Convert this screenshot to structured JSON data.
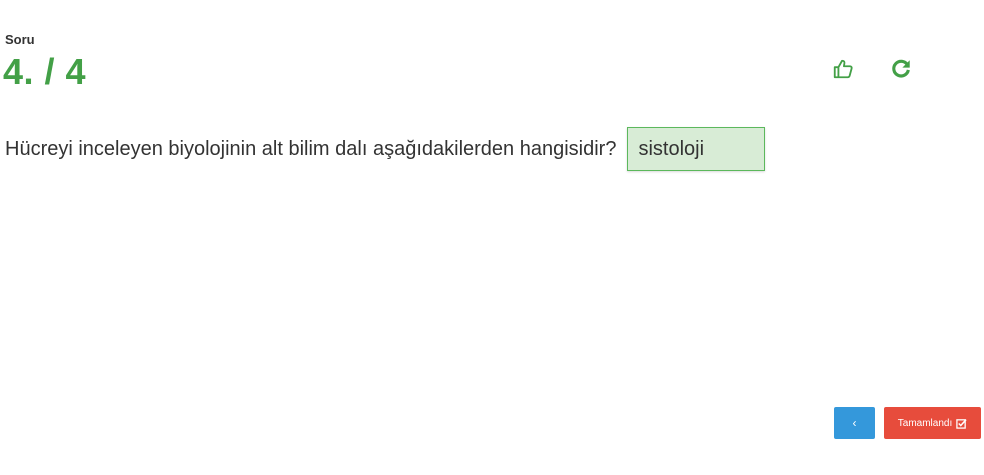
{
  "header": {
    "soru_label": "Soru",
    "counter": "4. / 4"
  },
  "actions": {
    "like_icon": "thumbs-up-icon",
    "redo_icon": "redo-icon"
  },
  "question": {
    "text": "Hücreyi inceleyen biyolojinin alt bilim dalı aşağıdakilerden hangisidir?",
    "answer_value": "sistoloji"
  },
  "footer": {
    "prev_label": "‹",
    "done_label": "Tamamlandı",
    "done_icon": "check-square-icon"
  },
  "colors": {
    "accent_green": "#43a047",
    "answer_bg": "#d8ecd6",
    "prev_blue": "#3498db",
    "done_red": "#e74c3c"
  }
}
